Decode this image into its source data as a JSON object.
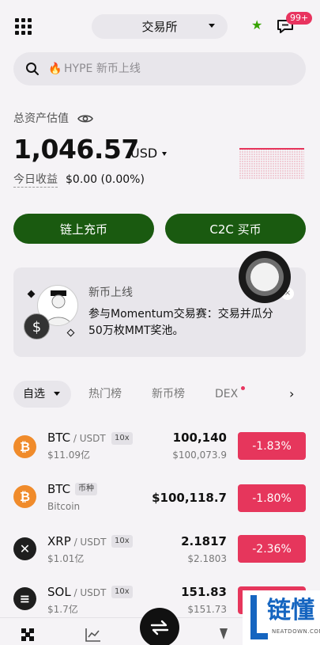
{
  "header": {
    "exchange_label": "交易所",
    "message_badge": "99+",
    "icons": [
      "grid-menu-icon",
      "star-icon",
      "message-icon"
    ],
    "accent_color": "#37a300"
  },
  "search": {
    "placeholder": "HYPE 新币上线",
    "icons": [
      "search-icon",
      "fire-icon"
    ]
  },
  "assets": {
    "label": "总资产估值",
    "value": "1,046.57",
    "currency": "USD",
    "today_label": "今日收益",
    "today_value": "$0.00 (0.00%)"
  },
  "actions": {
    "deposit_label": "链上充币",
    "c2c_label": "C2C 买币",
    "button_color": "#1a5a10"
  },
  "promo": {
    "title": "新币上线",
    "body": "参与Momentum交易赛：交易并瓜分50万枚MMT奖池。",
    "close": "×",
    "coin_symbol": "$"
  },
  "tabs": {
    "items": [
      "自选",
      "热门榜",
      "新币榜",
      "DEX"
    ],
    "more": "›",
    "dot_color": "#e8345f"
  },
  "market": {
    "rows": [
      {
        "coin": "BTC",
        "quote": " / USDT",
        "tag": "10x",
        "volume": "$11.09亿",
        "price": "100,140",
        "price_sub": "$100,073.9",
        "change": "-1.83%",
        "icon": "bitcoin-icon",
        "symbol": "₿"
      },
      {
        "coin": "BTC",
        "quote": "",
        "tag": "币种",
        "volume": "Bitcoin",
        "price": "$100,118.7",
        "price_sub": "",
        "change": "-1.80%",
        "icon": "bitcoin-icon",
        "symbol": "₿"
      },
      {
        "coin": "XRP",
        "quote": " / USDT",
        "tag": "10x",
        "volume": "$1.01亿",
        "price": "2.1817",
        "price_sub": "$2.1803",
        "change": "-2.36%",
        "icon": "xrp-icon",
        "symbol": "✕"
      },
      {
        "coin": "SOL",
        "quote": " / USDT",
        "tag": "10x",
        "volume": "$1.7亿",
        "price": "151.83",
        "price_sub": "$151.73",
        "change": "",
        "icon": "solana-icon",
        "symbol": "≡"
      }
    ],
    "negative_color": "#e6365c"
  },
  "bottom_nav": {
    "icons": [
      "home-icon",
      "market-chart-icon",
      "trade-swap-icon",
      "earn-icon"
    ]
  },
  "watermark": {
    "text": "链懂",
    "sub": "NEATDOWN.COM"
  }
}
